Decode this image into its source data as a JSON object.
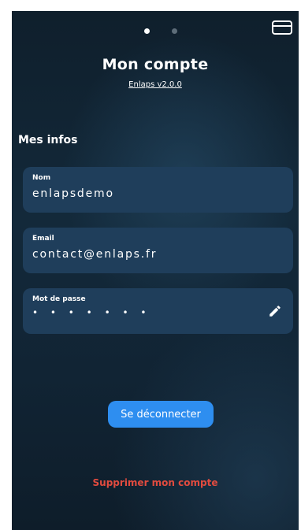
{
  "header": {
    "page_indicator": {
      "count": 2,
      "active_index": 0
    },
    "title": "Mon compte",
    "version": "Enlaps v2.0.0",
    "top_right_icon": "camera-icon"
  },
  "section": {
    "title": "Mes infos"
  },
  "fields": {
    "nom": {
      "label": "Nom",
      "value": "enlapsdemo"
    },
    "email": {
      "label": "Email",
      "value": "contact@enlaps.fr"
    },
    "password": {
      "label": "Mot de passe",
      "value": "• • • • • • •",
      "icon": "pencil-icon"
    }
  },
  "actions": {
    "logout_label": "Se déconnecter",
    "delete_label": "Supprimer mon compte"
  },
  "colors": {
    "background": "#13293a",
    "field_background": "#1f3e5b",
    "accent_blue": "#2e8ef0",
    "danger_red": "#e14b3f"
  }
}
